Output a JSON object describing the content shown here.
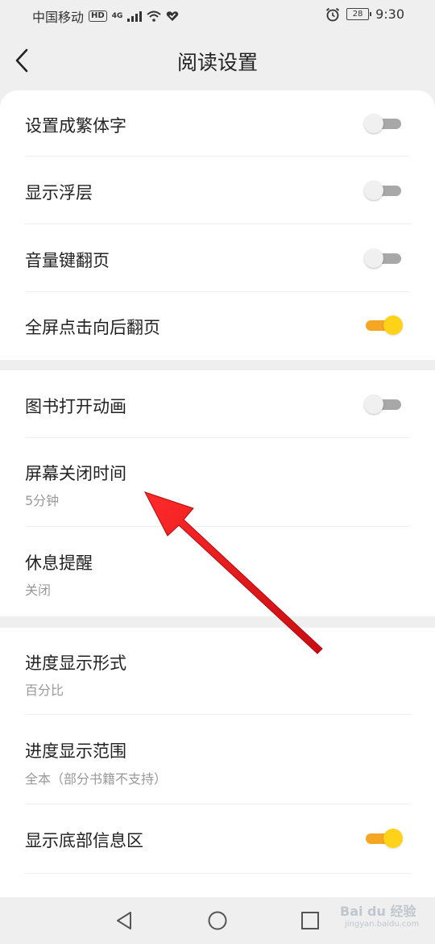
{
  "status_bar": {
    "carrier": "中国移动",
    "hd_badge": "HD",
    "network": "4G",
    "battery": "28",
    "time": "9:30",
    "icons": [
      "signal-icon",
      "wifi-icon",
      "heart-icon",
      "alarm-icon",
      "battery-icon"
    ]
  },
  "header": {
    "title": "阅读设置",
    "back_icon": "back-chevron-icon"
  },
  "colors": {
    "accent_track": "#f5a623",
    "accent_knob": "#ffd21a",
    "toggle_off_track": "#a8a8a8",
    "annotation_arrow": "#e8141a"
  },
  "settings": {
    "traditional": {
      "label": "设置成繁体字",
      "enabled": false
    },
    "floating_layer": {
      "label": "显示浮层",
      "enabled": false
    },
    "volume_page": {
      "label": "音量键翻页",
      "enabled": false
    },
    "fullscreen_tap": {
      "label": "全屏点击向后翻页",
      "enabled": true
    },
    "book_animation": {
      "label": "图书打开动画",
      "enabled": false
    },
    "screen_off": {
      "label": "屏幕关闭时间",
      "value": "5分钟"
    },
    "rest_reminder": {
      "label": "休息提醒",
      "value": "关闭"
    },
    "progress_format": {
      "label": "进度显示形式",
      "value": "百分比"
    },
    "progress_range": {
      "label": "进度显示范围",
      "value": "全本（部分书籍不支持）"
    },
    "bottom_info": {
      "label": "显示底部信息区",
      "enabled": true
    }
  },
  "nav_bar": {
    "icons": [
      "nav-back-triangle-icon",
      "nav-home-circle-icon",
      "nav-recents-square-icon"
    ]
  },
  "watermark": {
    "text": "Bai du 经验",
    "sub": "jingyan.baidu.com"
  }
}
